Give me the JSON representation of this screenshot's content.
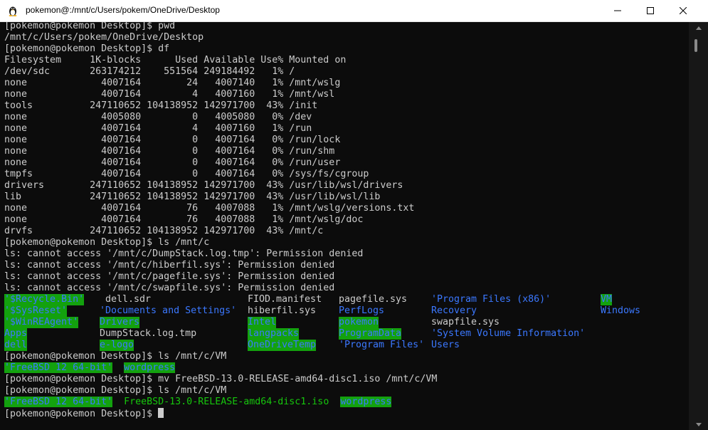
{
  "window": {
    "title": "pokemon@:/mnt/c/Users/pokem/OneDrive/Desktop"
  },
  "terminal": {
    "lines_top": [
      "[pokemon@pokemon Desktop]$ pwd",
      "/mnt/c/Users/pokem/OneDrive/Desktop",
      "[pokemon@pokemon Desktop]$ df",
      "Filesystem     1K-blocks      Used Available Use% Mounted on",
      "/dev/sdc       263174212    551564 249184492   1% /",
      "none             4007164        24   4007140   1% /mnt/wslg",
      "none             4007164         4   4007160   1% /mnt/wsl",
      "tools          247110652 104138952 142971700  43% /init",
      "none             4005080         0   4005080   0% /dev",
      "none             4007164         4   4007160   1% /run",
      "none             4007164         0   4007164   0% /run/lock",
      "none             4007164         0   4007164   0% /run/shm",
      "none             4007164         0   4007164   0% /run/user",
      "tmpfs            4007164         0   4007164   0% /sys/fs/cgroup",
      "drivers        247110652 104138952 142971700  43% /usr/lib/wsl/drivers",
      "lib            247110652 104138952 142971700  43% /usr/lib/wsl/lib",
      "none             4007164        76   4007088   1% /mnt/wslg/versions.txt",
      "none             4007164        76   4007088   1% /mnt/wslg/doc",
      "drvfs          247110652 104138952 142971700  43% /mnt/c",
      "[pokemon@pokemon Desktop]$ ls /mnt/c",
      "ls: cannot access '/mnt/c/DumpStack.log.tmp': Permission denied",
      "ls: cannot access '/mnt/c/hiberfil.sys': Permission denied",
      "ls: cannot access '/mnt/c/pagefile.sys': Permission denied",
      "ls: cannot access '/mnt/c/swapfile.sys': Permission denied"
    ],
    "ls_rows": [
      [
        {
          "text": "'$Recycle.Bin'",
          "style": "ow",
          "col": 0
        },
        {
          "text": " dell.sdr",
          "style": "file",
          "col": 1
        },
        {
          "text": "FIOD.manifest",
          "style": "file",
          "col": 2
        },
        {
          "text": "pagefile.sys",
          "style": "file",
          "col": 3
        },
        {
          "text": "'Program Files (x86)'",
          "style": "dir",
          "col": 4
        },
        {
          "text": "VM",
          "style": "ow",
          "col": 5
        }
      ],
      [
        {
          "text": "'$SysReset'",
          "style": "ow",
          "col": 0
        },
        {
          "text": "'Documents and Settings'",
          "style": "dir",
          "col": 1
        },
        {
          "text": "hiberfil.sys",
          "style": "file",
          "col": 2
        },
        {
          "text": "PerfLogs",
          "style": "dir",
          "col": 3
        },
        {
          "text": "Recovery",
          "style": "dir",
          "col": 4
        },
        {
          "text": "Windows",
          "style": "dir",
          "col": 5
        }
      ],
      [
        {
          "text": "'$WinREAgent'",
          "style": "ow",
          "col": 0
        },
        {
          "text": "Drivers",
          "style": "ow",
          "col": 1
        },
        {
          "text": "Intel",
          "style": "ow",
          "col": 2
        },
        {
          "text": "pokemon",
          "style": "ow",
          "col": 3
        },
        {
          "text": "swapfile.sys",
          "style": "file",
          "col": 4
        }
      ],
      [
        {
          "text": "Apps",
          "style": "ow",
          "col": 0
        },
        {
          "text": "DumpStack.log.tmp",
          "style": "file",
          "col": 1
        },
        {
          "text": "langpacks",
          "style": "ow",
          "col": 2
        },
        {
          "text": "ProgramData",
          "style": "ow",
          "col": 3
        },
        {
          "text": "'System Volume Information'",
          "style": "dir",
          "col": 4
        }
      ],
      [
        {
          "text": "dell",
          "style": "ow",
          "col": 0
        },
        {
          "text": "e-logo",
          "style": "ow",
          "col": 1
        },
        {
          "text": "OneDriveTemp",
          "style": "ow",
          "col": 2
        },
        {
          "text": "'Program Files'",
          "style": "dir",
          "col": 3
        },
        {
          "text": "Users",
          "style": "dir",
          "col": 4
        }
      ]
    ],
    "lines_bottom": [
      {
        "parts": [
          {
            "text": "[pokemon@pokemon Desktop]$ ls /mnt/c/VM",
            "style": "plain"
          }
        ]
      },
      {
        "parts": [
          {
            "text": "'FreeBSD 12 64-bit'",
            "style": "ow"
          },
          {
            "text": "  ",
            "style": "plain"
          },
          {
            "text": "wordpress",
            "style": "ow"
          }
        ]
      },
      {
        "parts": [
          {
            "text": "[pokemon@pokemon Desktop]$ mv FreeBSD-13.0-RELEASE-amd64-disc1.iso /mnt/c/VM",
            "style": "plain"
          }
        ]
      },
      {
        "parts": [
          {
            "text": "[pokemon@pokemon Desktop]$ ls /mnt/c/VM",
            "style": "plain"
          }
        ]
      },
      {
        "parts": [
          {
            "text": "'FreeBSD 12 64-bit'",
            "style": "ow"
          },
          {
            "text": "  ",
            "style": "plain"
          },
          {
            "text": "FreeBSD-13.0-RELEASE-amd64-disc1.iso",
            "style": "green"
          },
          {
            "text": "  ",
            "style": "plain"
          },
          {
            "text": "wordpress",
            "style": "ow"
          }
        ]
      },
      {
        "parts": [
          {
            "text": "[pokemon@pokemon Desktop]$ ",
            "style": "plain"
          }
        ],
        "cursor": true
      }
    ]
  },
  "colors": {
    "background": "#0c0c0c",
    "foreground": "#cccccc",
    "dir_blue": "#3b78ff",
    "ow_bg_green": "#13a10e",
    "exec_green": "#16c60c"
  },
  "icons": [
    "tux-icon",
    "minimize-icon",
    "maximize-icon",
    "close-icon",
    "scroll-up-icon",
    "scroll-down-icon"
  ]
}
